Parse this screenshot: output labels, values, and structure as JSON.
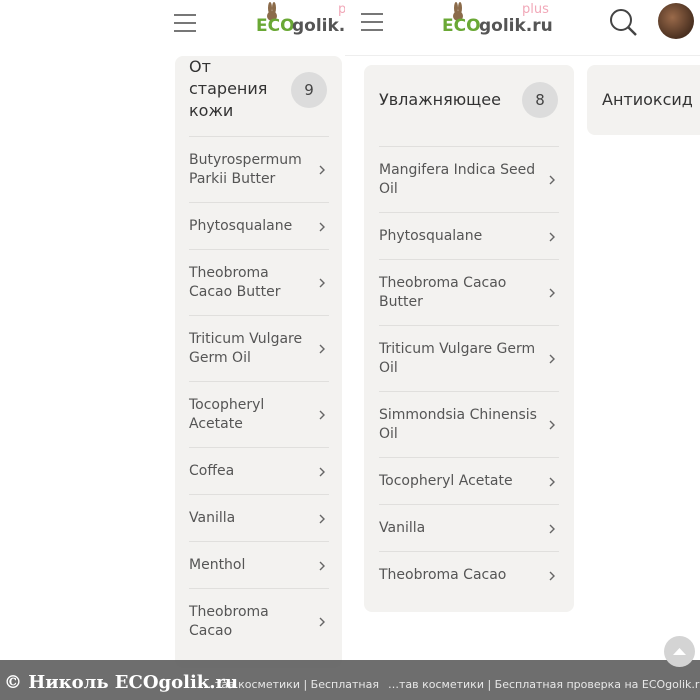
{
  "back": {
    "logo": {
      "eco": "ECO",
      "golik": "golik.r",
      "plus": "pl"
    },
    "card": {
      "title": "От старения кожи",
      "count": "9",
      "items": [
        "Butyrospermum Parkii Butter",
        "Phytosqualane",
        "Theobroma Cacao Butter",
        "Triticum Vulgare Germ Oil",
        "Tocopheryl Acetate",
        "Coffea",
        "Vanilla",
        "Menthol",
        "Theobroma Cacao"
      ]
    }
  },
  "front": {
    "logo": {
      "eco": "ECO",
      "golik": "golik.ru",
      "plus": "plus"
    },
    "card": {
      "title": "Увлажняющее",
      "count": "8",
      "items": [
        "Mangifera Indica Seed Oil",
        "Phytosqualane",
        "Theobroma Cacao Butter",
        "Triticum Vulgare Germ Oil",
        "Simmondsia Chinensis Oil",
        "Tocopheryl Acetate",
        "Vanilla",
        "Theobroma Cacao"
      ]
    },
    "next_card_title": "Антиоксид"
  },
  "footer": {
    "left_text": "…тав косметики | Бесплатная",
    "right_text": "…тав косметики | Бесплатная проверка на ECOgolik.ru"
  },
  "watermark": "© Николь ECOgolik.ru",
  "colors": {
    "accent_green": "#6aa835",
    "plus_pink": "#f1a8b8",
    "card_bg": "#f3f2f0"
  },
  "icons": [
    "hamburger-menu-icon",
    "search-icon",
    "chevron-right-icon",
    "scroll-to-top-icon",
    "bunny-logo-icon"
  ]
}
